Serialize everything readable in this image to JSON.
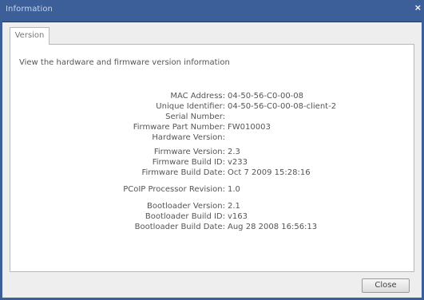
{
  "window": {
    "title": "Information",
    "close_glyph": "×"
  },
  "tabs": [
    {
      "label": "Version",
      "selected": true
    }
  ],
  "description": "View the hardware and firmware version information",
  "fields": {
    "mac_address": {
      "label": "MAC Address:",
      "value": "04-50-56-C0-00-08"
    },
    "unique_identifier": {
      "label": "Unique Identifier:",
      "value": "04-50-56-C0-00-08-client-2"
    },
    "serial_number": {
      "label": "Serial Number:",
      "value": ""
    },
    "firmware_part_number": {
      "label": "Firmware Part Number:",
      "value": "FW010003"
    },
    "hardware_version": {
      "label": "Hardware Version:",
      "value": ""
    },
    "firmware_version": {
      "label": "Firmware Version:",
      "value": "2.3"
    },
    "firmware_build_id": {
      "label": "Firmware Build ID:",
      "value": "v233"
    },
    "firmware_build_date": {
      "label": "Firmware Build Date:",
      "value": "Oct  7 2009 15:28:16"
    },
    "pcoip_processor_revision": {
      "label": "PCoIP Processor Revision:",
      "value": "1.0"
    },
    "bootloader_version": {
      "label": "Bootloader Version:",
      "value": "2.1"
    },
    "bootloader_build_id": {
      "label": "Bootloader Build ID:",
      "value": "v163"
    },
    "bootloader_build_date": {
      "label": "Bootloader Build Date:",
      "value": "Aug 28 2008 16:56:13"
    }
  },
  "buttons": {
    "close_label": "Close"
  },
  "colors": {
    "titlebar": "#3d5f99",
    "desktop": "#2c4c7e",
    "panel": "#ffffff",
    "dialog": "#eeeeee"
  }
}
